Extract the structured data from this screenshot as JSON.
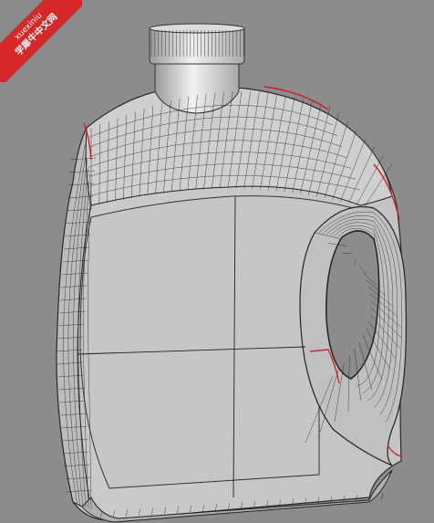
{
  "viewport": {
    "background": "#8c8c8c",
    "surface_color": "#c8c8c8",
    "wire_color": "#2a2a2a",
    "edge_highlight_color": "#cc2222"
  },
  "watermark": {
    "line1": "xuexiniu",
    "line2": "学犀牛中文网",
    "color": "#d62828"
  },
  "model": {
    "object": "bottle-with-handle",
    "display_mode": "shaded-wireframe"
  }
}
